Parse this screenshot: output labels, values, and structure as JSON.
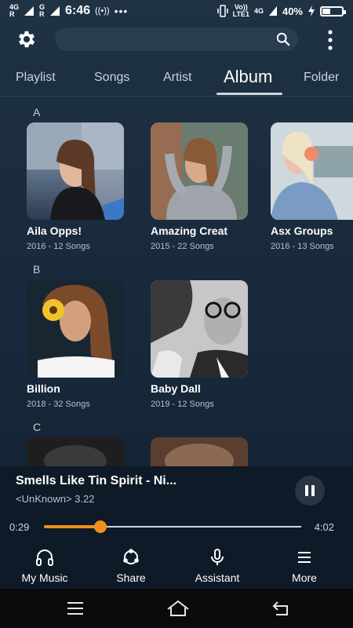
{
  "status_bar": {
    "sig1_top": "4G",
    "sig1_bottom": "R",
    "sig2_top": "G",
    "sig2_bottom": "R",
    "time": "6:46",
    "volte": "Vo))",
    "lte": "LTE1",
    "net": "4G",
    "battery_pct": "40%",
    "battery_level": 0.4
  },
  "top_bar": {
    "settings_icon": "gear-icon",
    "search_icon": "search-icon",
    "menu_icon": "more-vertical-icon"
  },
  "tabs": [
    {
      "label": "Playlist"
    },
    {
      "label": "Songs"
    },
    {
      "label": "Artist"
    },
    {
      "label": "Album"
    },
    {
      "label": "Folder"
    }
  ],
  "active_tab": "Album",
  "sections": [
    {
      "letter": "A",
      "albums": [
        {
          "title": "Aila Opps!",
          "meta": "2016 - 12 Songs"
        },
        {
          "title": "Amazing Creat",
          "meta": "2015 - 22 Songs"
        },
        {
          "title": "Asx Groups",
          "meta": "2016 - 13 Songs"
        }
      ]
    },
    {
      "letter": "B",
      "albums": [
        {
          "title": "Billion",
          "meta": "2018 - 32 Songs"
        },
        {
          "title": "Baby Dall",
          "meta": "2019 - 12 Songs"
        }
      ]
    },
    {
      "letter": "C",
      "albums": []
    }
  ],
  "player": {
    "track_title": "Smells Like Tin Spirit - Ni...",
    "track_artist": "<UnKnown> 3.22",
    "current_time": "0:29",
    "total_time": "4:02",
    "progress": 0.22,
    "accent": "#f0901a"
  },
  "bottom_nav": [
    {
      "label": "My Music",
      "icon": "headphones-icon"
    },
    {
      "label": "Share",
      "icon": "share-icon"
    },
    {
      "label": "Assistant",
      "icon": "microphone-icon"
    },
    {
      "label": "More",
      "icon": "hamburger-icon"
    }
  ],
  "system_nav": {
    "icons": [
      "menu-icon",
      "home-icon",
      "back-icon"
    ]
  }
}
